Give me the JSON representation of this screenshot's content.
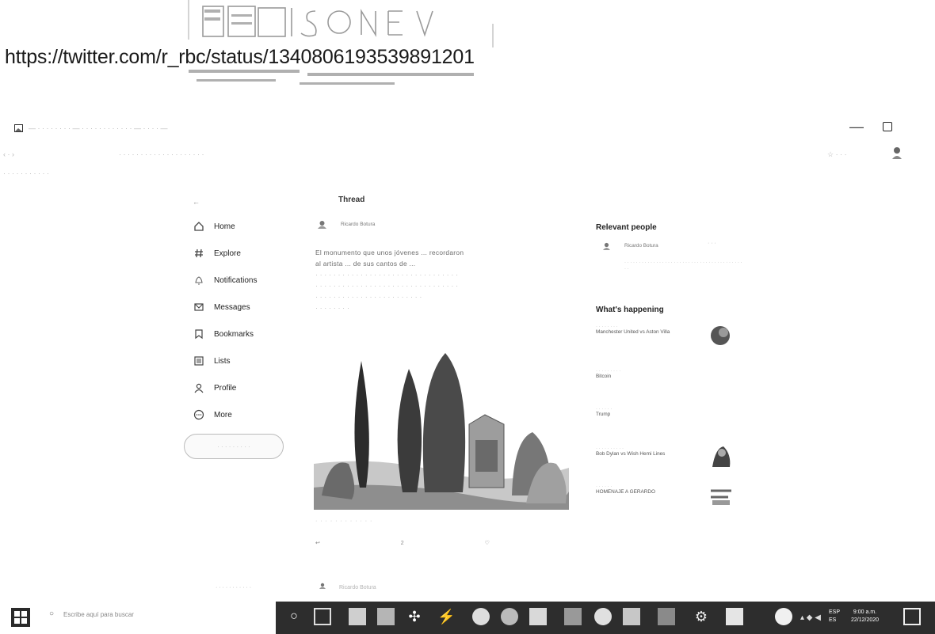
{
  "stamp": {
    "url": "https://twitter.com/r_rbc/status/1340806193539891201"
  },
  "browser": {
    "tab_text": "— · · · · · · · · — · · · · · · · · · · · · — · · · · —",
    "address_text": "· · · · · · · · · · · · · · · · · · · ·",
    "bookmarks_text": "· · · · · · · · · · ·",
    "minimize": "—",
    "restore": "☐"
  },
  "nav": {
    "back_arrow": "←",
    "items": [
      {
        "label": "Home",
        "icon": "home-icon"
      },
      {
        "label": "Explore",
        "icon": "hash-icon"
      },
      {
        "label": "Notifications",
        "icon": "bell-icon"
      },
      {
        "label": "Messages",
        "icon": "mail-icon"
      },
      {
        "label": "Bookmarks",
        "icon": "bookmark-icon"
      },
      {
        "label": "Lists",
        "icon": "list-icon"
      },
      {
        "label": "Profile",
        "icon": "person-icon"
      },
      {
        "label": "More",
        "icon": "more-icon"
      }
    ],
    "tweet_button": "· · · · · · · · ·"
  },
  "thread": {
    "title": "Thread",
    "author": "Ricardo Botura",
    "lines": [
      "El monumento que unos jóvenes ... recordaron",
      "al artista ... de sus cantos de ... "
    ]
  },
  "right": {
    "relevant_heading": "Relevant people",
    "person_name": "Ricardo Botura",
    "whats_happening": "What's happening",
    "trends": [
      {
        "sub": "· · · · · · · ·",
        "title": "Manchester United vs Aston Villa"
      },
      {
        "sub": "· · · · · · · · ·",
        "title": "Bitcoin"
      },
      {
        "sub": "· · · · · ·",
        "title": "Trump"
      },
      {
        "sub": "· · · · · · · · · ·",
        "title": "Bob Dylan vs Wish Hemi Lines"
      },
      {
        "sub": "· · · · · ·",
        "title": "HOMENAJE A GERARDO"
      }
    ]
  },
  "taskbar": {
    "search_text": "Escribe aquí para buscar",
    "lang": "ESP",
    "lang2": "ES",
    "time": "9:00 a.m.",
    "date": "22/12/2020"
  },
  "colors": {
    "taskbar_dark": "#2d2d2d",
    "ink": "#111111",
    "faint": "#b4b4b4"
  }
}
